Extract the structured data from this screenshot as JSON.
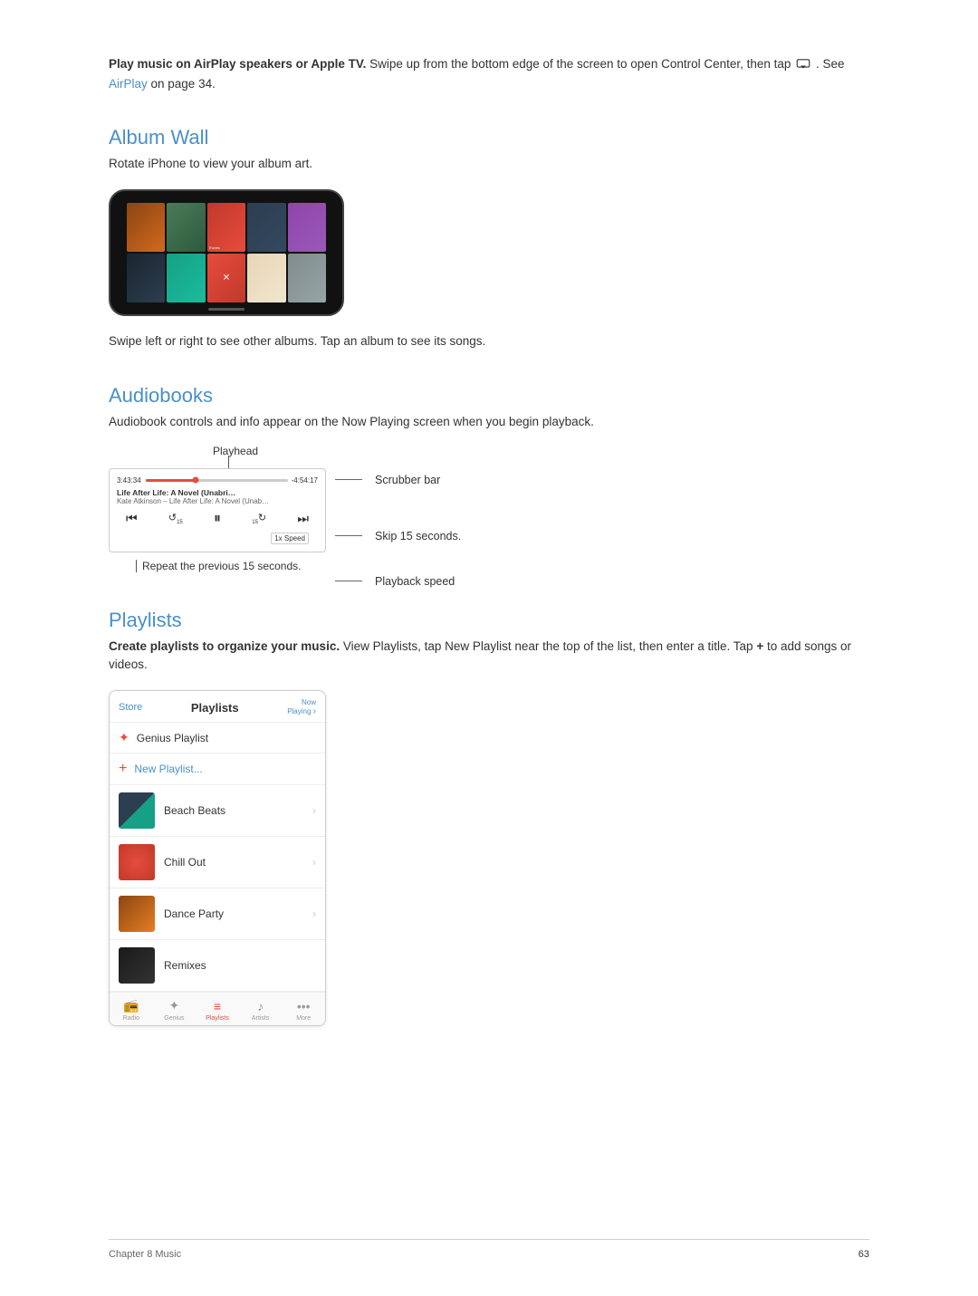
{
  "intro": {
    "text_bold": "Play music on AirPlay speakers or Apple TV.",
    "text_normal": " Swipe up from the bottom edge of the screen to open Control Center, then tap",
    "text_after": ". See",
    "airplay_link": "AirPlay",
    "airplay_page": " on page 34."
  },
  "album_wall": {
    "heading": "Album Wall",
    "subtext": "Rotate iPhone to view your album art.",
    "swipe_text": "Swipe left or right to see other albums. Tap an album to see its songs."
  },
  "audiobooks": {
    "heading": "Audiobooks",
    "subtext": "Audiobook controls and info appear on the Now Playing screen when you begin playback.",
    "playhead_label": "Playhead",
    "scrubber_label": "Scrubber bar",
    "skip_label": "Skip 15 seconds.",
    "playback_speed_label": "Playback speed",
    "repeat_label": "Repeat the previous 15 seconds.",
    "time_start": "3:43:34",
    "time_end": "-4:54:17",
    "book_title": "Life After Life: A Novel (Unabri…",
    "book_author": "Kate Atkinson – Life After Life: A Novel (Unab…",
    "speed_text": "1x Speed"
  },
  "playlists": {
    "heading": "Playlists",
    "subtext_bold": "Create playlists to organize your music.",
    "subtext_normal": " View Playlists, tap New Playlist near the top of the list, then enter a title. Tap",
    "plus_symbol": "+",
    "subtext_after": " to add songs or videos.",
    "store_label": "Store",
    "playlists_title": "Playlists",
    "now_playing": "Now Playing",
    "genius_label": "Genius Playlist",
    "new_playlist_label": "New Playlist...",
    "items": [
      {
        "name": "Beach Beats"
      },
      {
        "name": "Chill Out"
      },
      {
        "name": "Dance Party"
      },
      {
        "name": "Remixes"
      }
    ],
    "tabs": [
      {
        "label": "Radio",
        "icon": "📻",
        "active": false
      },
      {
        "label": "Genius",
        "icon": "✦",
        "active": false
      },
      {
        "label": "Playlists",
        "icon": "≡",
        "active": true
      },
      {
        "label": "Artists",
        "icon": "♪",
        "active": false
      },
      {
        "label": "More",
        "icon": "•••",
        "active": false
      }
    ]
  },
  "footer": {
    "chapter": "Chapter 8    Music",
    "page_number": "63"
  }
}
